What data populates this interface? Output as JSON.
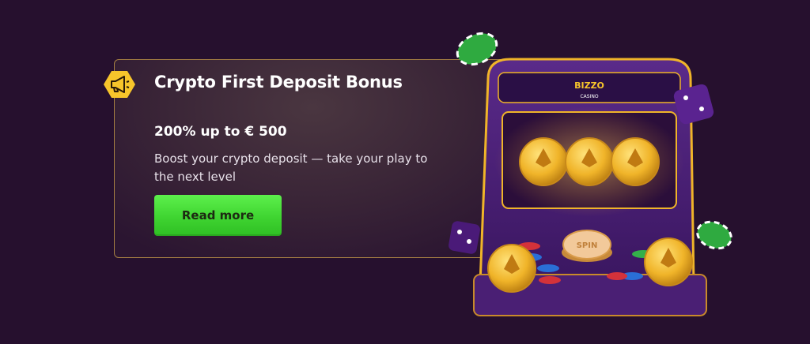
{
  "promo": {
    "title": "Crypto First Deposit Bonus",
    "amount": "200% up to € 500",
    "description": "Boost your crypto deposit — take your play to the next level",
    "button_label": "Read more",
    "badge_icon": "megaphone-icon"
  },
  "machine": {
    "logo_text": "BIZZO",
    "logo_sub": "CASINO",
    "spin_label": "SPIN"
  },
  "colors": {
    "background": "#26102e",
    "card_border": "#a57f43",
    "button_green": "#3fd431",
    "badge_yellow": "#f7c52b",
    "gold": "#f0b429"
  }
}
